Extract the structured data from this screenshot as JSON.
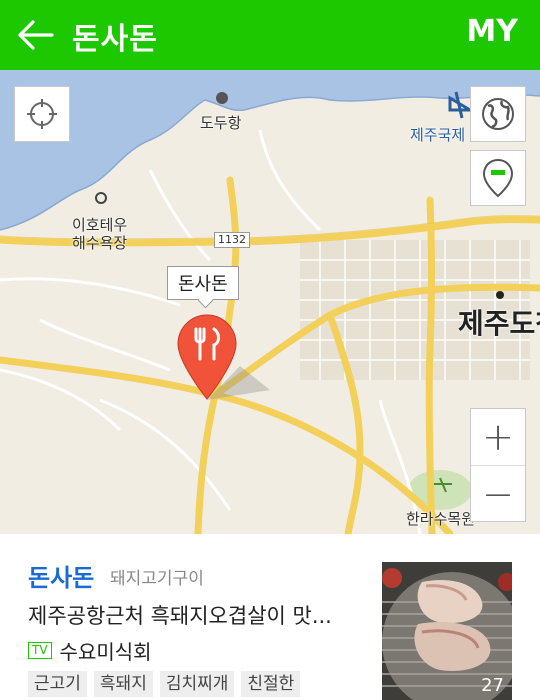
{
  "header": {
    "title": "돈사돈",
    "my_label": "MY"
  },
  "map": {
    "labels": {
      "dodu_port": "도두항",
      "jeju_airport": "제주국제",
      "ihotewoo_1": "이호테우",
      "ihotewoo_2": "해수욕장",
      "road_number": "1132",
      "jeju_city": "제주도청",
      "halla_arboretum": "한라수목원"
    },
    "marker_label": "돈사돈",
    "zoom_in_label": "+",
    "zoom_out_label": "−"
  },
  "place": {
    "name": "돈사돈",
    "category": "돼지고기구이",
    "description": "제주공항근처 흑돼지오겹살이 맛...",
    "tv_badge": "TV",
    "tv_show": "수요미식회",
    "tags": [
      "근고기",
      "흑돼지",
      "김치찌개",
      "친절한"
    ],
    "photo_count": "27"
  },
  "colors": {
    "brand": "#1ec800",
    "name_link": "#1a6ad4",
    "road": "#f6d55a",
    "sea": "#a9c3e5"
  }
}
